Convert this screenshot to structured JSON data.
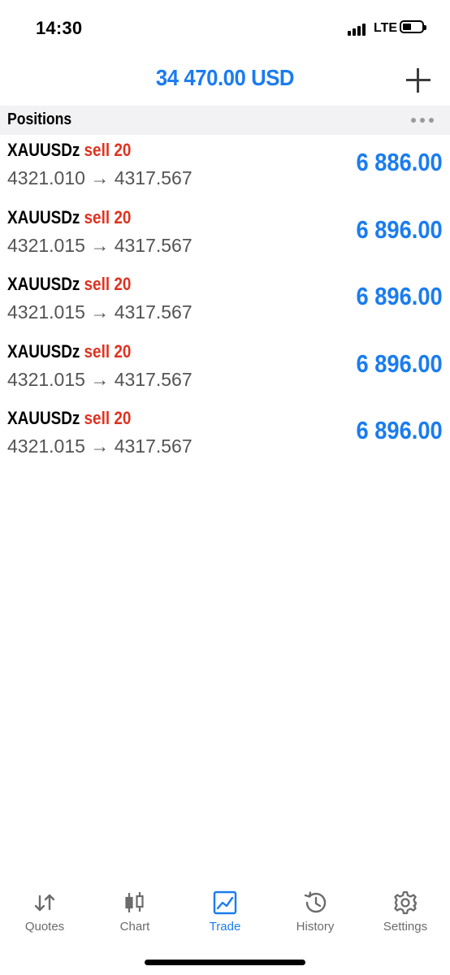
{
  "status": {
    "time": "14:30",
    "network": "LTE"
  },
  "header": {
    "balance": "34 470.00 USD"
  },
  "section": {
    "title": "Positions"
  },
  "positions": [
    {
      "symbol": "XAUUSDz",
      "side": "sell 20",
      "prices": "4321.010 → 4317.567",
      "profit": "6 886.00"
    },
    {
      "symbol": "XAUUSDz",
      "side": "sell 20",
      "prices": "4321.015 → 4317.567",
      "profit": "6 896.00"
    },
    {
      "symbol": "XAUUSDz",
      "side": "sell 20",
      "prices": "4321.015 → 4317.567",
      "profit": "6 896.00"
    },
    {
      "symbol": "XAUUSDz",
      "side": "sell 20",
      "prices": "4321.015 → 4317.567",
      "profit": "6 896.00"
    },
    {
      "symbol": "XAUUSDz",
      "side": "sell 20",
      "prices": "4321.015 → 4317.567",
      "profit": "6 896.00"
    }
  ],
  "tabs": [
    {
      "label": "Quotes",
      "icon": "quotes-icon"
    },
    {
      "label": "Chart",
      "icon": "chart-icon"
    },
    {
      "label": "Trade",
      "icon": "trade-icon",
      "active": true
    },
    {
      "label": "History",
      "icon": "history-icon"
    },
    {
      "label": "Settings",
      "icon": "settings-icon"
    }
  ],
  "colors": {
    "accent": "#1a7cf0",
    "sell": "#e0321f",
    "inactive": "#6b6b6b"
  }
}
